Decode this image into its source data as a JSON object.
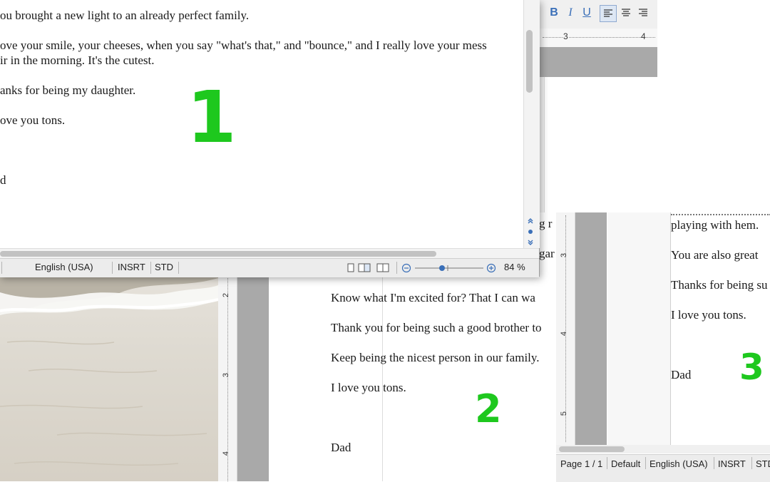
{
  "window1": {
    "lines": [
      "ou brought a new light to an already perfect family.",
      "ove your smile, your cheeses, when you say \"what's that,\" and \"bounce,\" and I really love your mess",
      "ir in the morning.  It's the cutest.",
      "anks for being my daughter.",
      "ove you tons.",
      "d"
    ],
    "number": "1",
    "status": {
      "language": "English (USA)",
      "insert": "INSRT",
      "mode": "STD",
      "zoom": "84 %"
    }
  },
  "window2": {
    "partial": [
      "g r",
      "gar"
    ],
    "lines": [
      "Know what I'm excited for?  That I can wa",
      "Thank you for being such a good brother to",
      "Keep being the nicest person in our family.",
      "I love you tons.",
      "Dad"
    ],
    "number": "2",
    "ruler": [
      "2",
      "3",
      "4"
    ]
  },
  "window3": {
    "lines": [
      "playing with hem.",
      "You are also great",
      "Thanks for being su",
      "I love you tons.",
      "Dad"
    ],
    "number": "3",
    "ruler": [
      "3",
      "4",
      "5"
    ],
    "status": {
      "page": "Page 1 / 1",
      "style": "Default",
      "language": "English (USA)",
      "insert": "INSRT",
      "mode": "STD"
    }
  },
  "toolbar": {
    "bold": "B",
    "italic": "I",
    "underline": "U",
    "ruler": [
      "3",
      "4"
    ]
  },
  "colors": {
    "number": "#1ec81e",
    "accent": "#3a6fb8",
    "gray_band": "#a9a9a9"
  }
}
